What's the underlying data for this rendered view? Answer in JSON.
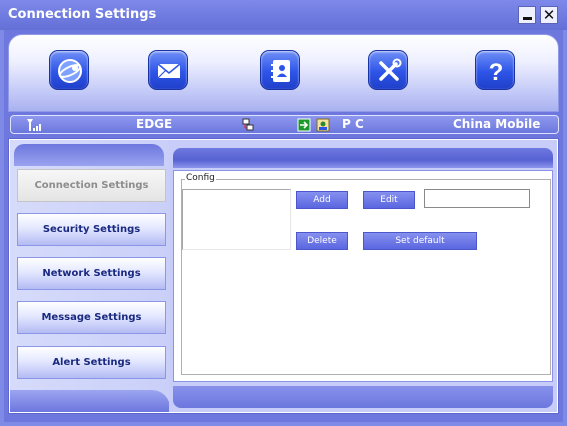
{
  "window": {
    "title": "Connection Settings",
    "minimize": "_",
    "close": "✕"
  },
  "toolbar": {
    "items": [
      {
        "name": "Internet",
        "icon": "globe-icon"
      },
      {
        "name": "Messages",
        "icon": "envelope-icon"
      },
      {
        "name": "Contacts",
        "icon": "address-book-icon"
      },
      {
        "name": "Settings",
        "icon": "tools-icon"
      },
      {
        "name": "Help",
        "icon": "question-icon"
      }
    ]
  },
  "status": {
    "signal_icon": "signal-strength-icon",
    "network_type": "EDGE",
    "connection_icon": "network-connection-icon",
    "sms_icon": "sms-icon",
    "media_icon": "media-icon",
    "mode": "P C",
    "operator": "China Mobile"
  },
  "sidebar": {
    "items": [
      {
        "label": "Connection Settings",
        "active": true
      },
      {
        "label": "Security Settings",
        "active": false
      },
      {
        "label": "Network Settings",
        "active": false
      },
      {
        "label": "Message Settings",
        "active": false
      },
      {
        "label": "Alert Settings",
        "active": false
      }
    ]
  },
  "config": {
    "group_label": "Config",
    "add_label": "Add",
    "edit_label": "Edit",
    "delete_label": "Delete",
    "set_default_label": "Set default",
    "name_value": ""
  },
  "colors": {
    "accent": "#6d77de",
    "button": "#5a66e0",
    "text_dark": "#1a2a80"
  }
}
